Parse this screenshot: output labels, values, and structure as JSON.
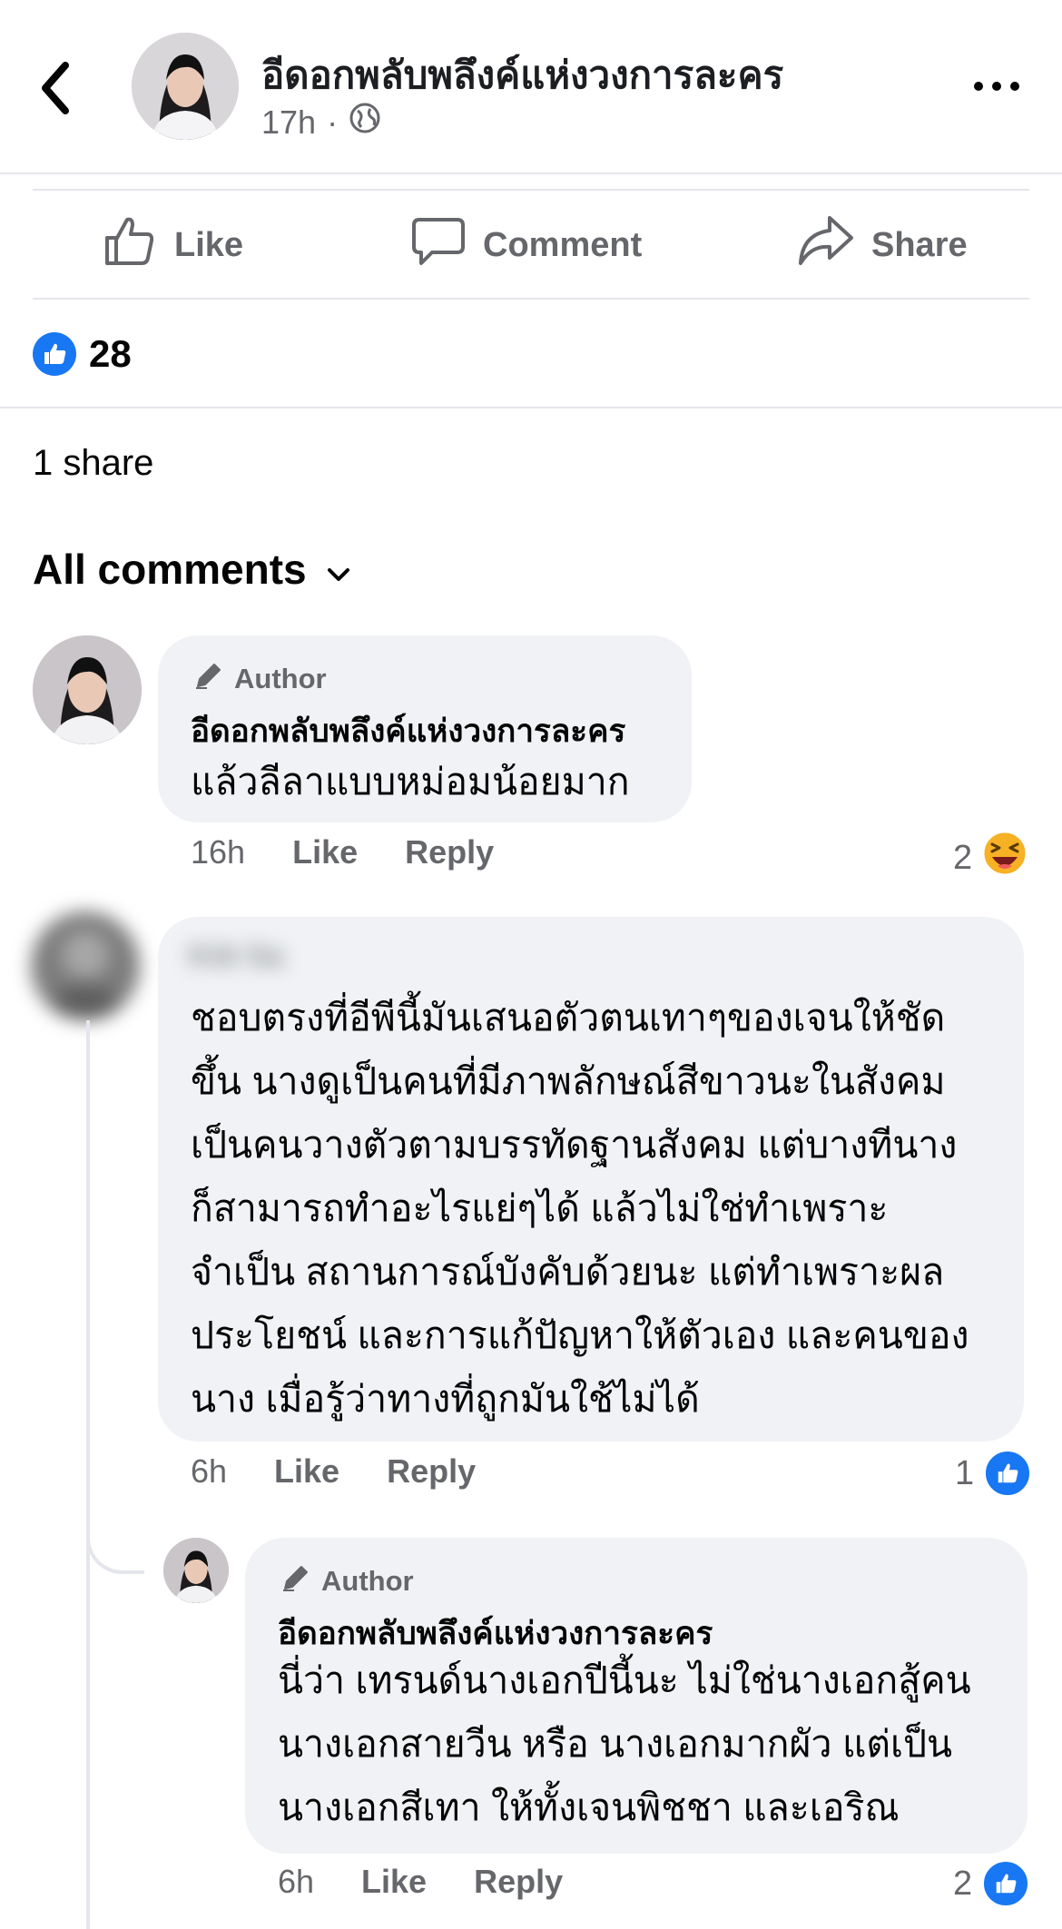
{
  "header": {
    "page_name": "อีดอกพลับพลึงค์แห่งวงการละคร",
    "time": "17h",
    "separator": "·",
    "audience_icon": "globe-icon",
    "back_icon": "back-arrow-icon",
    "more_icon": "more-icon"
  },
  "actions": {
    "like": "Like",
    "comment": "Comment",
    "share": "Share"
  },
  "reactions": {
    "count": "28",
    "icon": "like-reaction-icon"
  },
  "shares": {
    "label": "1 share"
  },
  "comments_header": {
    "label": "All comments",
    "icon": "chevron-down-icon"
  },
  "comments": [
    {
      "badge": "Author",
      "name": "อีดอกพลับพลึงค์แห่งวงการละคร",
      "lines": [
        "แล้วลีลาแบบหม่อมน้อยมาก"
      ],
      "time": "16h",
      "like": "Like",
      "reply": "Reply",
      "reaction_count": "2",
      "reaction_icon": "laughing-emoji-icon"
    },
    {
      "name": "Kitt Sa",
      "lines": [
        "ชอบตรงที่อีพีนี้มันเสนอตัวตนเทาๆของเจนให้ชัด",
        "ขึ้น นางดูเป็นคนที่มีภาพลักษณ์สีขาวนะในสังคม",
        "เป็นคนวางตัวตามบรรทัดฐานสังคม แต่บางทีนาง",
        "ก็สามารถทำอะไรแย่ๆได้ แล้วไม่ใช่ทำเพราะ",
        "จำเป็น สถานการณ์บังคับด้วยนะ แต่ทำเพราะผล",
        "ประโยชน์ และการแก้ปัญหาให้ตัวเอง และคนของ",
        "นาง เมื่อรู้ว่าทางที่ถูกมันใช้ไม่ได้"
      ],
      "time": "6h",
      "like": "Like",
      "reply": "Reply",
      "reaction_count": "1",
      "reaction_icon": "like-reaction-icon"
    },
    {
      "badge": "Author",
      "name": "อีดอกพลับพลึงค์แห่งวงการละคร",
      "lines": [
        "นี่ว่า เทรนด์นางเอกปีนี้นะ ไม่ใช่นางเอกสู้คน",
        "นางเอกสายวีน หรือ นางเอกมากผัว  แต่เป็น",
        "นางเอกสีเทา ให้ทั้งเจนพิชชา และเอริณ"
      ],
      "time": "6h",
      "like": "Like",
      "reply": "Reply",
      "reaction_count": "2",
      "reaction_icon": "like-reaction-icon"
    }
  ],
  "colors": {
    "accent": "#1877f2",
    "muted": "#65676b",
    "bubble": "#f0f2f5"
  }
}
